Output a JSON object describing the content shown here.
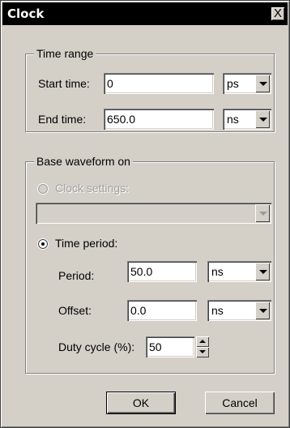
{
  "window": {
    "title": "Clock",
    "close_label": "X"
  },
  "time_range": {
    "legend": "Time range",
    "start_label": "Start time:",
    "start_value": "0",
    "start_unit": "ps",
    "end_label": "End time:",
    "end_value": "650.0",
    "end_unit": "ns"
  },
  "base_waveform": {
    "legend": "Base waveform on",
    "clock_settings_label": "Clock settings:",
    "clock_settings_value": "",
    "clock_settings_enabled": false,
    "time_period_label": "Time period:",
    "selected_option": "time_period",
    "period_label": "Period:",
    "period_value": "50.0",
    "period_unit": "ns",
    "offset_label": "Offset:",
    "offset_value": "0.0",
    "offset_unit": "ns",
    "duty_cycle_label": "Duty cycle (%):",
    "duty_cycle_value": "50"
  },
  "buttons": {
    "ok_label": "OK",
    "cancel_label": "Cancel"
  }
}
